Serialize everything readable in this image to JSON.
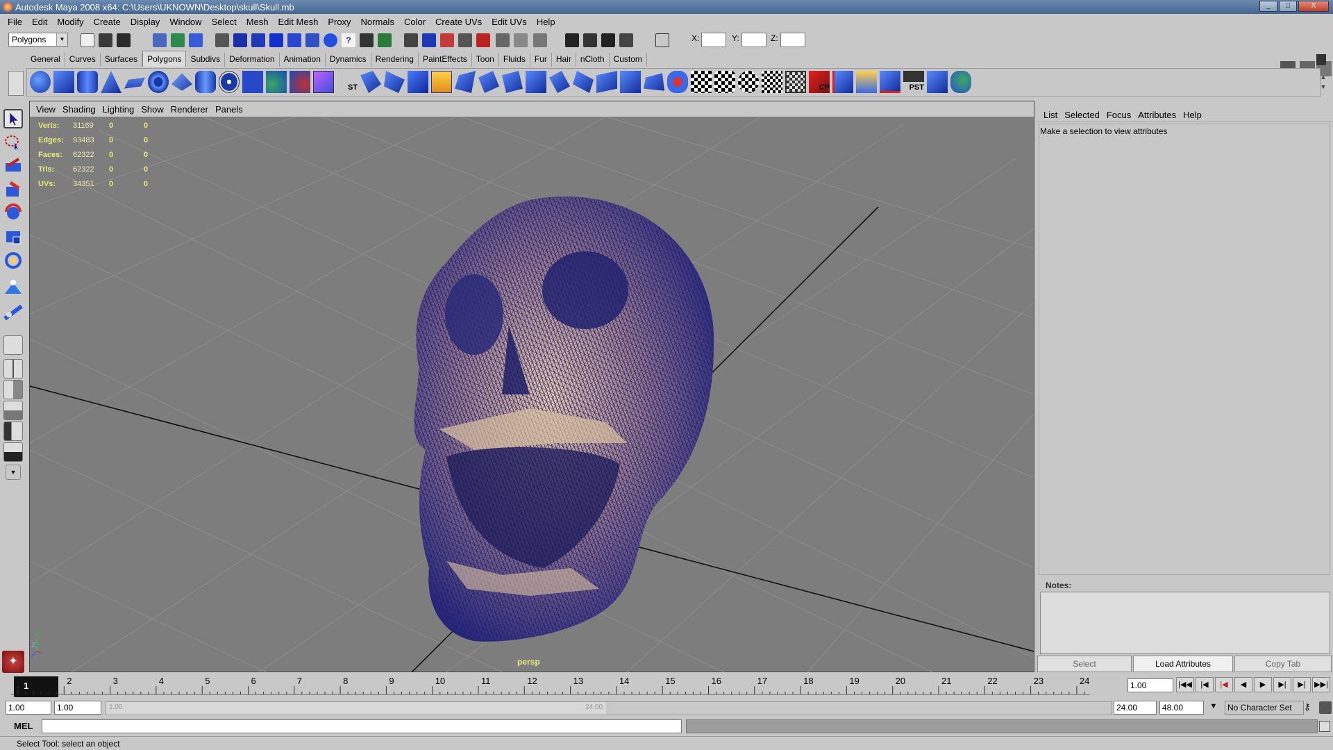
{
  "window": {
    "title": "Autodesk Maya 2008 x64: C:\\Users\\UKNOWN\\Desktop\\skull\\Skull.mb",
    "controls": [
      "_",
      "□",
      "X"
    ]
  },
  "menubar": [
    "File",
    "Edit",
    "Modify",
    "Create",
    "Display",
    "Window",
    "Select",
    "Mesh",
    "Edit Mesh",
    "Proxy",
    "Normals",
    "Color",
    "Create UVs",
    "Edit UVs",
    "Help"
  ],
  "status_line": {
    "mode": "Polygons",
    "x_label": "X:",
    "y_label": "Y:",
    "z_label": "Z:"
  },
  "shelf_tabs": [
    "General",
    "Curves",
    "Surfaces",
    "Polygons",
    "Subdivs",
    "Deformation",
    "Animation",
    "Dynamics",
    "Rendering",
    "PaintEffects",
    "Toon",
    "Fluids",
    "Fur",
    "Hair",
    "nCloth",
    "Custom"
  ],
  "active_shelf_tab": "Polygons",
  "shelf_icon_texts": [
    "ST",
    "CP",
    "PST"
  ],
  "panel_menu": [
    "View",
    "Shading",
    "Lighting",
    "Show",
    "Renderer",
    "Panels"
  ],
  "hud": {
    "rows": [
      {
        "label": "Verts:",
        "v1": "31169",
        "v2": "0",
        "v3": "0"
      },
      {
        "label": "Edges:",
        "v1": "93483",
        "v2": "0",
        "v3": "0"
      },
      {
        "label": "Faces:",
        "v1": "62322",
        "v2": "0",
        "v3": "0"
      },
      {
        "label": "Tris:",
        "v1": "62322",
        "v2": "0",
        "v3": "0"
      },
      {
        "label": "UVs:",
        "v1": "34351",
        "v2": "0",
        "v3": "0"
      }
    ]
  },
  "viewport": {
    "camera": "persp",
    "axis_y": "Y",
    "axis_z": "Z"
  },
  "attribute_editor": {
    "menu": [
      "List",
      "Selected",
      "Focus",
      "Attributes",
      "Help"
    ],
    "message": "Make a selection to view attributes",
    "notes_label": "Notes:",
    "buttons": [
      "Select",
      "Load Attributes",
      "Copy Tab"
    ]
  },
  "time_slider": {
    "ticks": [
      "1",
      "2",
      "3",
      "4",
      "5",
      "6",
      "7",
      "8",
      "9",
      "10",
      "11",
      "12",
      "13",
      "14",
      "15",
      "16",
      "17",
      "18",
      "19",
      "20",
      "21",
      "22",
      "23",
      "24"
    ],
    "current_frame": "1",
    "current_time": "1.00"
  },
  "range_slider": {
    "start": "1.00",
    "anim_start": "1.00",
    "end": "24.00",
    "anim_end": "48.00",
    "marker_left": "1.00",
    "marker_right": "24.00",
    "character_set": "No Character Set"
  },
  "command_line": {
    "label": "MEL"
  },
  "help_line": "Select Tool: select an object",
  "colors": {
    "viewport_bg": "#7d7d7d",
    "wire": "#1c1c8a",
    "hud": "#e8e880",
    "ui_bg": "#c8c8c8"
  }
}
